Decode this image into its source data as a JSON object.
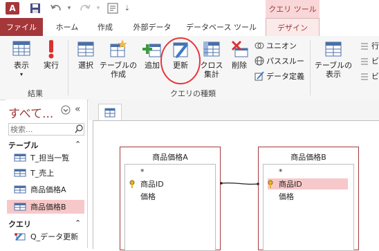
{
  "title_bar": {
    "app_logo": "A",
    "context_tab": "クエリ ツール"
  },
  "tabs": {
    "file": "ファイル",
    "home": "ホーム",
    "create": "作成",
    "external": "外部データ",
    "dbtools": "データベース ツール",
    "design": "デザイン"
  },
  "ribbon": {
    "view": "表示",
    "run": "実行",
    "select": "選択",
    "make_table_l1": "テーブルの",
    "make_table_l2": "作成",
    "append": "追加",
    "update": "更新",
    "crosstab_l1": "クロス",
    "crosstab_l2": "集計",
    "delete": "削除",
    "union": "ユニオン",
    "passthrough": "パススルー",
    "data_def": "データ定義",
    "show_table_l1": "テーブルの",
    "show_table_l2": "表示",
    "right_items": [
      "行",
      "ビ",
      "ビ"
    ],
    "group_results": "結果",
    "group_query_type": "クエリの種類"
  },
  "nav": {
    "title": "すべて...",
    "search_placeholder": "検索...",
    "tables_header": "テーブル",
    "tables": [
      "T_担当一覧",
      "T_売上",
      "商品価格A",
      "商品価格B"
    ],
    "queries_header": "クエリ",
    "queries": [
      "Q_データ更新"
    ]
  },
  "design": {
    "table_a": {
      "title": "商品価格A",
      "fields": [
        "*",
        "商品ID",
        "価格"
      ]
    },
    "table_b": {
      "title": "商品価格B",
      "fields": [
        "*",
        "商品ID",
        "価格"
      ]
    }
  },
  "colors": {
    "accent": "#a4373a",
    "highlight_circle": "#e8353a",
    "selected_row": "#f7c8c9"
  }
}
